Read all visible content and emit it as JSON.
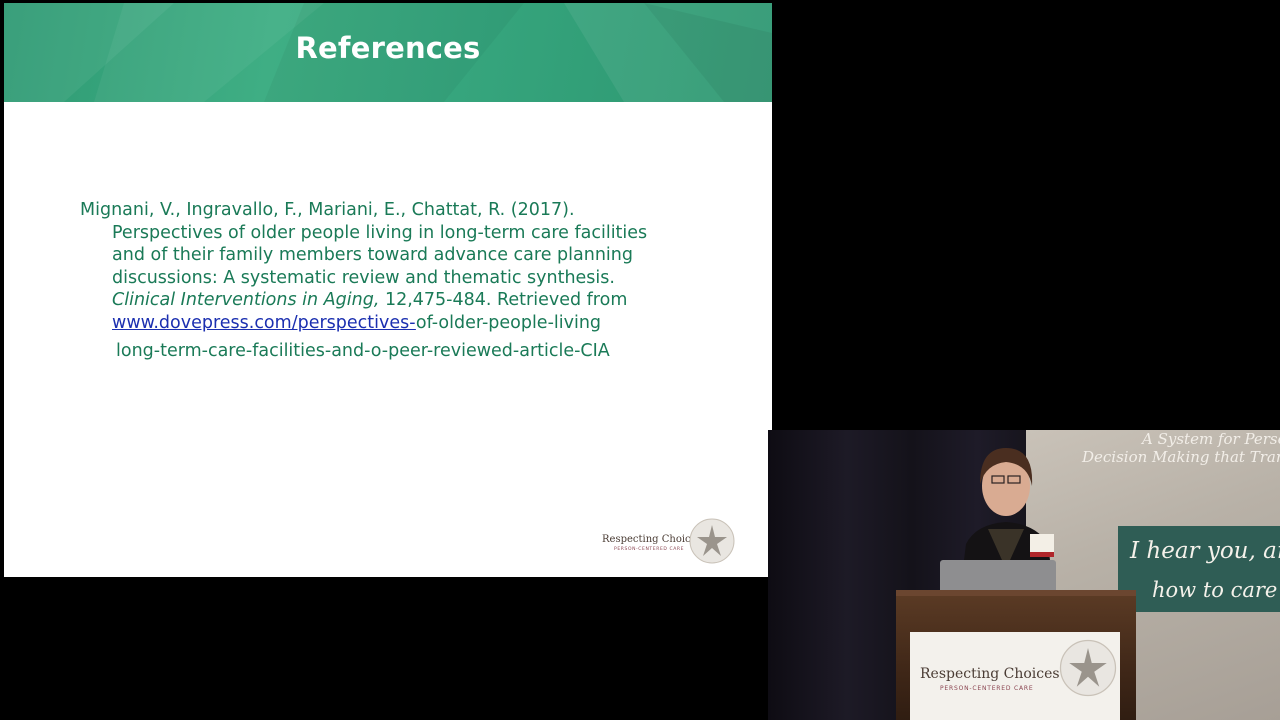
{
  "slide": {
    "title": "References",
    "reference": {
      "line1": "Mignani, V., Ingravallo, F., Mariani, E., Chattat, R. (2017).",
      "line2": "Perspectives of older people living in long-term care facilities",
      "line3": "and of their family members toward advance care planning",
      "line4": "discussions: A systematic review and thematic synthesis.",
      "journal": "Clinical Interventions in Aging,",
      "journal_rest": " 12,475-484.  Retrieved from",
      "link": "www.dovepress.com/perspectives-",
      "link_rest": "of-older-people-living",
      "line7": "long-term-care-facilities-and-o-peer-reviewed-article-CIA"
    },
    "logo": {
      "name": "Respecting Choices",
      "sub": "PERSON-CENTERED CARE"
    },
    "colors": {
      "header": "#36a57d",
      "body_text": "#1a7a57",
      "link": "#1b2fb0"
    }
  },
  "video": {
    "banner_line_1": "A System for Person",
    "banner_line_2": "Decision Making that Tran",
    "banner_line_3": "I hear you, and n",
    "banner_line_4": "how to care fo",
    "podium_logo": "Respecting Choices",
    "podium_sub": "PERSON-CENTERED CARE"
  }
}
